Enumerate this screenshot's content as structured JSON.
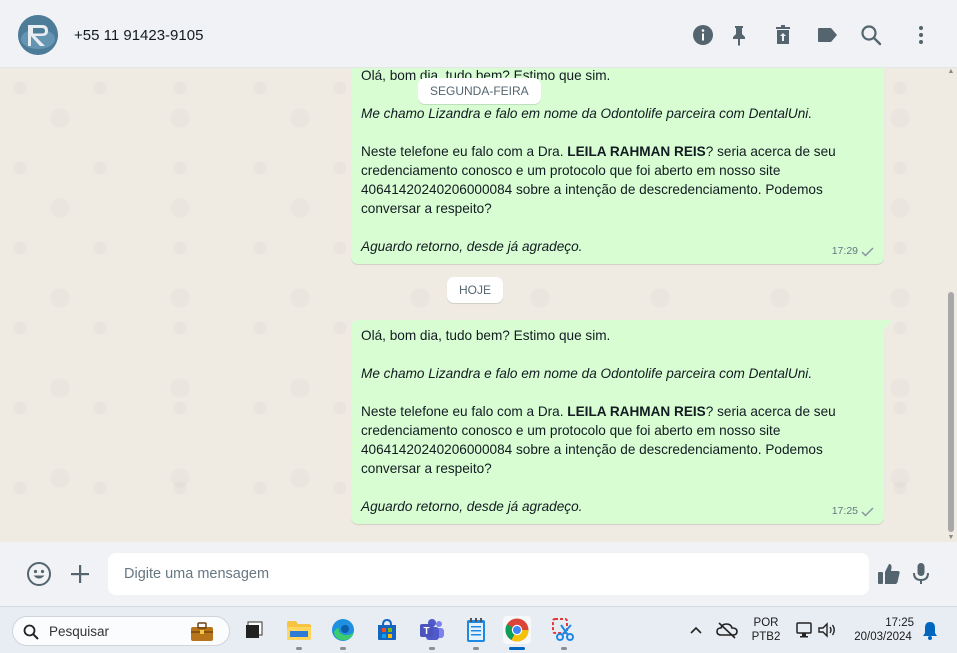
{
  "header": {
    "contact_name": "+55 11 91423-9105",
    "icons": [
      "info-icon",
      "pin-icon",
      "delete-icon",
      "label-icon",
      "search-icon",
      "menu-icon"
    ]
  },
  "chat": {
    "date_chips": [
      "SEGUNDA-FEIRA",
      "HOJE"
    ],
    "messages": [
      {
        "greeting": "Olá, bom dia, tudo bem? Estimo que sim.",
        "intro": "Me chamo Lizandra e falo em nome da Odontolife parceira com DentalUni.",
        "body_prefix": "Neste telefone eu falo com a Dra. ",
        "doctor": "LEILA RAHMAN REIS",
        "body_suffix": "? seria acerca de seu credenciamento conosco e um protocolo que foi aberto em nosso site 40641420240206000084 sobre a intenção de descredenciamento. Podemos conversar a respeito?",
        "closing": "Aguardo retorno, desde já agradeço.",
        "time": "17:29"
      },
      {
        "greeting": "Olá, bom dia, tudo bem? Estimo que sim.",
        "intro": "Me chamo Lizandra e falo em nome da Odontolife parceira com DentalUni.",
        "body_prefix": "Neste telefone eu falo com a Dra. ",
        "doctor": "LEILA RAHMAN REIS",
        "body_suffix": "? seria acerca de seu credenciamento conosco e um protocolo que foi aberto em nosso site 40641420240206000084 sobre a intenção de descredenciamento. Podemos conversar a respeito?",
        "closing": "Aguardo retorno, desde já agradeço.",
        "time": "17:25"
      }
    ]
  },
  "composer": {
    "placeholder": "Digite uma mensagem"
  },
  "taskbar": {
    "search_label": "Pesquisar",
    "lang_line1": "POR",
    "lang_line2": "PTB2",
    "time": "17:25",
    "date": "20/03/2024"
  },
  "colors": {
    "bubble_out": "#d9fdd3",
    "chat_bg": "#efeae2",
    "header_bg": "#f0f2f5",
    "icon_gray": "#54656f"
  }
}
